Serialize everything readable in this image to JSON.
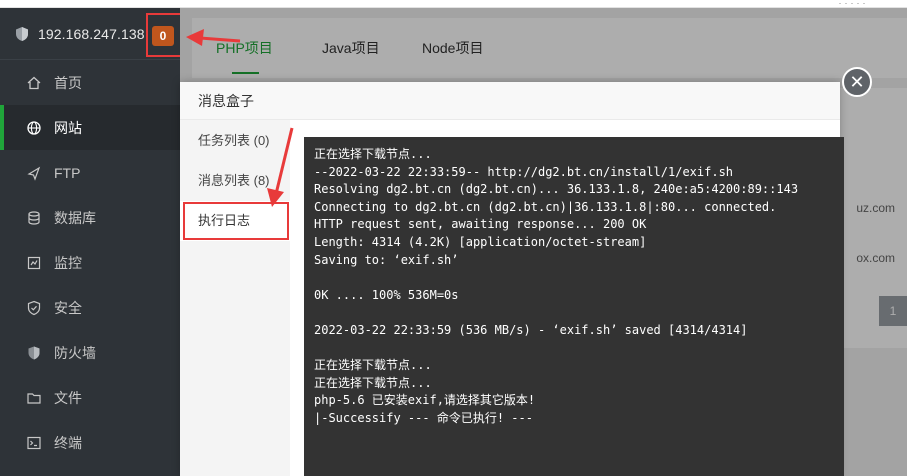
{
  "server": {
    "ip": "192.168.247.138",
    "badge_count": "0"
  },
  "sidebar": {
    "items": [
      {
        "label": "首页",
        "icon": "home-icon"
      },
      {
        "label": "网站",
        "icon": "globe-icon"
      },
      {
        "label": "FTP",
        "icon": "ftp-icon"
      },
      {
        "label": "数据库",
        "icon": "database-icon"
      },
      {
        "label": "监控",
        "icon": "monitor-icon"
      },
      {
        "label": "安全",
        "icon": "shield-check-icon"
      },
      {
        "label": "防火墙",
        "icon": "firewall-icon"
      },
      {
        "label": "文件",
        "icon": "folder-icon"
      },
      {
        "label": "终端",
        "icon": "terminal-icon"
      }
    ],
    "active_index": 1
  },
  "main": {
    "tabs": [
      {
        "label": "PHP项目"
      },
      {
        "label": "Java项目"
      },
      {
        "label": "Node项目"
      }
    ],
    "row_texts": [
      "uz.com",
      "ox.com"
    ],
    "pager_current": "1"
  },
  "modal": {
    "title": "消息盒子",
    "menu": [
      {
        "label": "任务列表 (0)"
      },
      {
        "label": "消息列表 (8)"
      },
      {
        "label": "执行日志"
      }
    ],
    "log_lines": [
      "正在选择下载节点...",
      "--2022-03-22 22:33:59-- http://dg2.bt.cn/install/1/exif.sh",
      "Resolving dg2.bt.cn (dg2.bt.cn)... 36.133.1.8, 240e:a5:4200:89::143",
      "Connecting to dg2.bt.cn (dg2.bt.cn)|36.133.1.8|:80... connected.",
      "HTTP request sent, awaiting response... 200 OK",
      "Length: 4314 (4.2K) [application/octet-stream]",
      "Saving to: ‘exif.sh’",
      "",
      "0K .... 100% 536M=0s",
      "",
      "2022-03-22 22:33:59 (536 MB/s) - ‘exif.sh’ saved [4314/4314]",
      "",
      "正在选择下载节点...",
      "正在选择下载节点...",
      "php-5.6 已安装exif,请选择其它版本!",
      "|-Successify --- 命令已执行! ---"
    ]
  },
  "colors": {
    "accent": "#20a53a",
    "sidebar_bg": "#2e3338",
    "badge": "#c0561d",
    "highlight": "#e83a3a",
    "console_bg": "#333333"
  }
}
